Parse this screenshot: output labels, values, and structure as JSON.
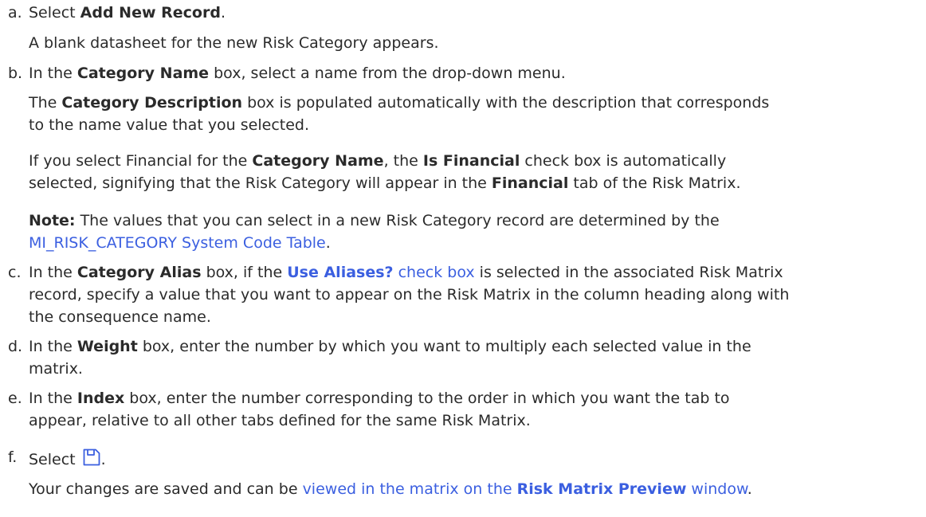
{
  "steps": [
    {
      "letter": "a.",
      "main": {
        "pre": "Select ",
        "bold": "Add New Record",
        "post": "."
      },
      "detail": "A blank datasheet for the new Risk Category appears."
    },
    {
      "letter": "b.",
      "main": {
        "pre": "In the ",
        "bold": "Category Name",
        "post": " box, select a name from the drop-down menu."
      },
      "desc": {
        "pre": "The ",
        "bold": "Category Description",
        "post1": " box is populated automatically with the description that corresponds",
        "line2": "to the name value that you selected."
      },
      "financial": {
        "pre": "If you select Financial for the ",
        "bold1": "Category Name",
        "mid": ", the ",
        "bold2": "Is Financial",
        "post1": " check box is automatically",
        "line2pre": "selected, signifying that the Risk Category will appear in the ",
        "bold3": "Financial",
        "line2post": " tab of the Risk Matrix."
      },
      "note": {
        "label": "Note:",
        "text": " The values that you can select in a new Risk Category record are determined by the",
        "link": "MI_RISK_CATEGORY System Code Table",
        "post": "."
      }
    },
    {
      "letter": "c.",
      "pre": "In the ",
      "bold": "Category Alias",
      "mid": " box, if the ",
      "link_bold": "Use Aliases?",
      "link_text": " check box",
      "post1": " is selected in the associated Risk Matrix",
      "line2": "record, specify a value that you want to appear on the Risk Matrix in the column heading along with",
      "line3": "the consequence name."
    },
    {
      "letter": "d.",
      "pre": "In the ",
      "bold": "Weight",
      "post1": " box, enter the number by which you want to multiply each selected value in the",
      "line2": "matrix."
    },
    {
      "letter": "e.",
      "pre": "In the ",
      "bold": "Index",
      "post1": " box, enter the number corresponding to the order in which you want the tab to",
      "line2": "appear, relative to all other tabs defined for the same Risk Matrix."
    },
    {
      "letter": "f.",
      "pre": "Select ",
      "icon": "save-icon",
      "post": ".",
      "result_pre": "Your changes are saved and can be ",
      "result_link1": "viewed in the matrix on the ",
      "result_link_bold": "Risk Matrix Preview",
      "result_link2": " window",
      "result_post": "."
    }
  ],
  "colors": {
    "text": "#2b2b2b",
    "link": "#3b5fe0",
    "icon": "#3b5fe0"
  }
}
